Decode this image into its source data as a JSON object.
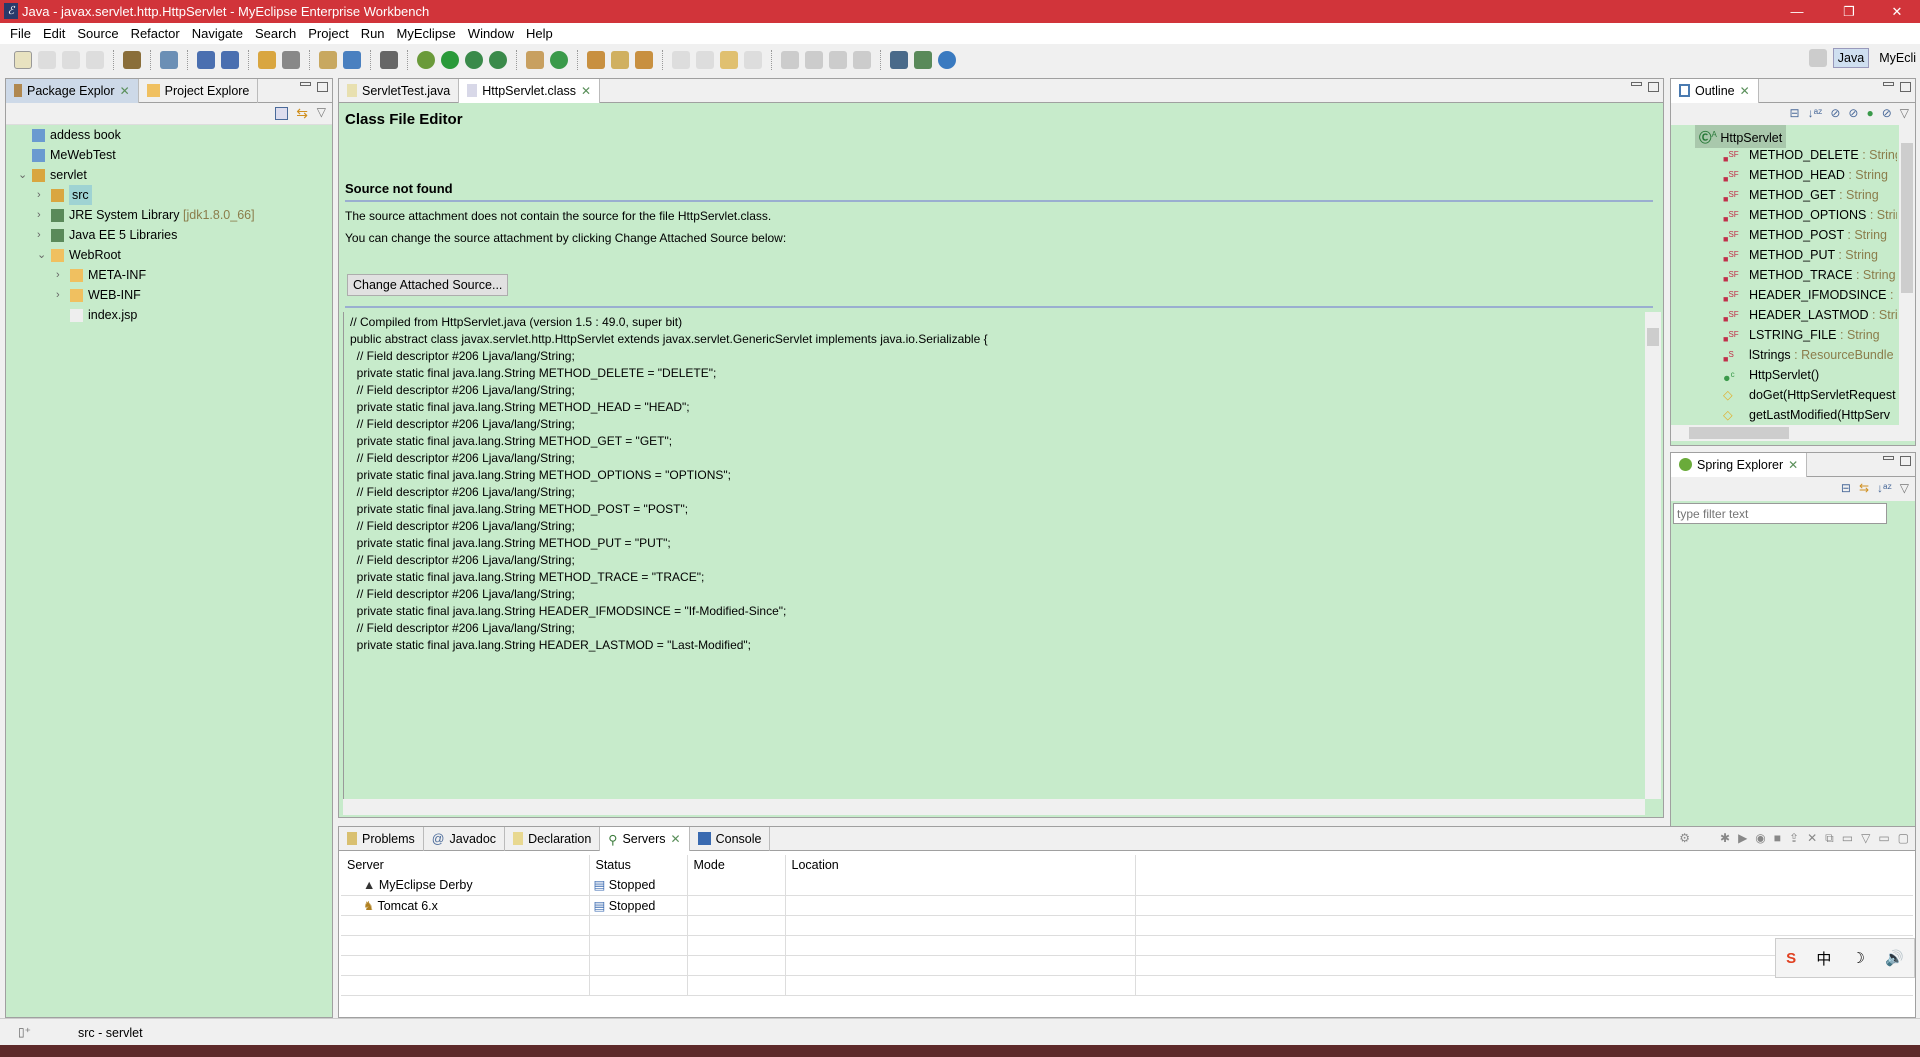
{
  "window": {
    "title": "Java - javax.servlet.http.HttpServlet - MyEclipse Enterprise Workbench",
    "minimize": "—",
    "maximize": "❐",
    "close": "✕"
  },
  "menu": [
    "File",
    "Edit",
    "Source",
    "Refactor",
    "Navigate",
    "Search",
    "Project",
    "Run",
    "MyEclipse",
    "Window",
    "Help"
  ],
  "perspectives": {
    "java": "Java",
    "myeclipse": "MyEcli"
  },
  "left_panel": {
    "tabs": [
      "Package Explor",
      "Project Explore"
    ],
    "tree": [
      {
        "label": "addess book",
        "extra": "",
        "depth": 0,
        "twisty": ""
      },
      {
        "label": "MeWebTest",
        "extra": "",
        "depth": 0,
        "twisty": ""
      },
      {
        "label": "servlet",
        "extra": "",
        "depth": 0,
        "twisty": "v"
      },
      {
        "label": "src",
        "extra": "",
        "depth": 1,
        "twisty": ">"
      },
      {
        "label": "JRE System Library",
        "extra": "[jdk1.8.0_66]",
        "depth": 1,
        "twisty": ">"
      },
      {
        "label": "Java EE 5 Libraries",
        "extra": "",
        "depth": 1,
        "twisty": ">"
      },
      {
        "label": "WebRoot",
        "extra": "",
        "depth": 1,
        "twisty": "v"
      },
      {
        "label": "META-INF",
        "extra": "",
        "depth": 2,
        "twisty": ">"
      },
      {
        "label": "WEB-INF",
        "extra": "",
        "depth": 2,
        "twisty": ">"
      },
      {
        "label": "index.jsp",
        "extra": "",
        "depth": 2,
        "twisty": ""
      }
    ]
  },
  "editor": {
    "tabs": [
      "ServletTest.java",
      "HttpServlet.class"
    ],
    "heading": "Class File Editor",
    "subheading": "Source not found",
    "msg1": "The source attachment does not contain the source for the file HttpServlet.class.",
    "msg2": "You can change the source attachment by clicking Change Attached Source below:",
    "button": "Change Attached Source...",
    "code": [
      "// Compiled from HttpServlet.java (version 1.5 : 49.0, super bit)",
      "public abstract class javax.servlet.http.HttpServlet extends javax.servlet.GenericServlet implements java.io.Serializable {",
      "",
      "  // Field descriptor #206 Ljava/lang/String;",
      "  private static final java.lang.String METHOD_DELETE = \"DELETE\";",
      "",
      "  // Field descriptor #206 Ljava/lang/String;",
      "  private static final java.lang.String METHOD_HEAD = \"HEAD\";",
      "",
      "  // Field descriptor #206 Ljava/lang/String;",
      "  private static final java.lang.String METHOD_GET = \"GET\";",
      "",
      "  // Field descriptor #206 Ljava/lang/String;",
      "  private static final java.lang.String METHOD_OPTIONS = \"OPTIONS\";",
      "",
      "  // Field descriptor #206 Ljava/lang/String;",
      "  private static final java.lang.String METHOD_POST = \"POST\";",
      "",
      "  // Field descriptor #206 Ljava/lang/String;",
      "  private static final java.lang.String METHOD_PUT = \"PUT\";",
      "",
      "  // Field descriptor #206 Ljava/lang/String;",
      "  private static final java.lang.String METHOD_TRACE = \"TRACE\";",
      "",
      "  // Field descriptor #206 Ljava/lang/String;",
      "  private static final java.lang.String HEADER_IFMODSINCE = \"If-Modified-Since\";",
      "",
      "  // Field descriptor #206 Ljava/lang/String;",
      "  private static final java.lang.String HEADER_LASTMOD = \"Last-Modified\";"
    ]
  },
  "outline": {
    "tab": "Outline",
    "root": "HttpServlet",
    "items": [
      {
        "name": "METHOD_DELETE",
        "type": " : String",
        "kind": "SF"
      },
      {
        "name": "METHOD_HEAD",
        "type": " : String",
        "kind": "SF"
      },
      {
        "name": "METHOD_GET",
        "type": " : String",
        "kind": "SF"
      },
      {
        "name": "METHOD_OPTIONS",
        "type": " : String",
        "kind": "SF"
      },
      {
        "name": "METHOD_POST",
        "type": " : String",
        "kind": "SF"
      },
      {
        "name": "METHOD_PUT",
        "type": " : String",
        "kind": "SF"
      },
      {
        "name": "METHOD_TRACE",
        "type": " : String",
        "kind": "SF"
      },
      {
        "name": "HEADER_IFMODSINCE",
        "type": " : String",
        "kind": "SF"
      },
      {
        "name": "HEADER_LASTMOD",
        "type": " : String",
        "kind": "SF"
      },
      {
        "name": "LSTRING_FILE",
        "type": " : String",
        "kind": "SF"
      },
      {
        "name": "lStrings",
        "type": " : ResourceBundle",
        "kind": "S"
      },
      {
        "name": "HttpServlet()",
        "type": "",
        "kind": "C"
      },
      {
        "name": "doGet(HttpServletRequest",
        "type": "",
        "kind": "M"
      },
      {
        "name": "getLastModified(HttpServ",
        "type": "",
        "kind": "M"
      }
    ]
  },
  "spring": {
    "tab": "Spring Explorer",
    "filter_placeholder": "type filter text"
  },
  "bottom": {
    "tabs": [
      "Problems",
      "Javadoc",
      "Declaration",
      "Servers",
      "Console"
    ],
    "columns": [
      "Server",
      "Status",
      "Mode",
      "Location"
    ],
    "rows": [
      {
        "server": "MyEclipse Derby",
        "status": "Stopped",
        "mode": "",
        "location": ""
      },
      {
        "server": "Tomcat  6.x",
        "status": "Stopped",
        "mode": "",
        "location": ""
      }
    ]
  },
  "status": {
    "text": "src - servlet"
  },
  "ime": [
    "S",
    "中",
    "☽",
    "🔊"
  ]
}
